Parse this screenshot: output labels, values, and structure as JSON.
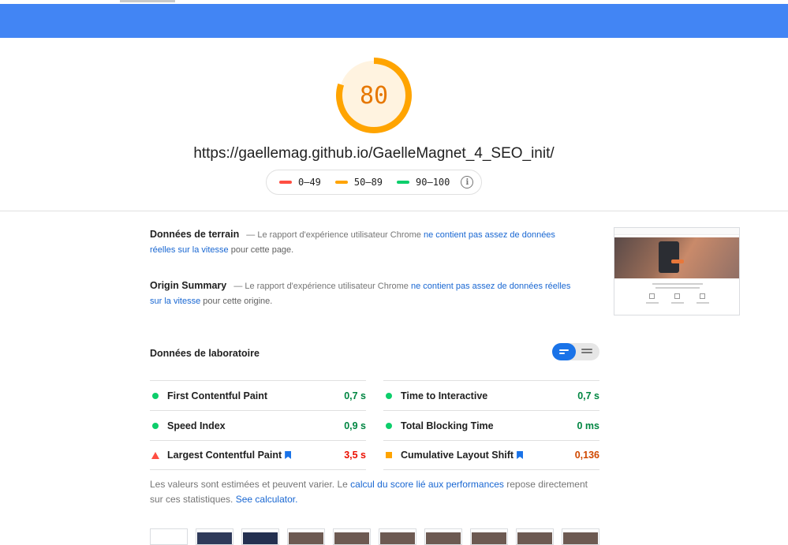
{
  "score": {
    "value": "80",
    "fraction": 0.8,
    "color": "#ffa400"
  },
  "url": "https://gaellemag.github.io/GaelleMagnet_4_SEO_init/",
  "legend": [
    {
      "range": "0–49",
      "status": "fail",
      "color": "#ff4e42"
    },
    {
      "range": "50–89",
      "status": "average",
      "color": "#ffa400"
    },
    {
      "range": "90–100",
      "status": "pass",
      "color": "#0cce6b"
    }
  ],
  "field_data": {
    "title": "Données de terrain",
    "prefix": "— Le rapport d'expérience utilisateur Chrome",
    "link": "ne contient pas assez de données réelles sur la vitesse",
    "suffix": "pour cette page."
  },
  "origin_summary": {
    "title": "Origin Summary",
    "prefix": "— Le rapport d'expérience utilisateur Chrome",
    "link": "ne contient pas assez de données réelles sur la vitesse",
    "suffix": "pour cette origine."
  },
  "lab": {
    "title": "Données de laboratoire",
    "metrics_left": [
      {
        "name": "First Contentful Paint",
        "value": "0,7 s",
        "status": "pass"
      },
      {
        "name": "Speed Index",
        "value": "0,9 s",
        "status": "pass"
      },
      {
        "name": "Largest Contentful Paint",
        "value": "3,5 s",
        "status": "fail",
        "bookmark": true
      }
    ],
    "metrics_right": [
      {
        "name": "Time to Interactive",
        "value": "0,7 s",
        "status": "pass"
      },
      {
        "name": "Total Blocking Time",
        "value": "0 ms",
        "status": "pass"
      },
      {
        "name": "Cumulative Layout Shift",
        "value": "0,136",
        "status": "average",
        "bookmark": true
      }
    ]
  },
  "note": {
    "part1": "Les valeurs sont estimées et peuvent varier. Le",
    "link1": "calcul du score lié aux performances",
    "part2": "repose directement sur ces statistiques.",
    "link2": "See calculator."
  },
  "colors": {
    "header": "#4285f4",
    "pass": "#0cce6b",
    "average": "#ffa400",
    "fail": "#ff4e42",
    "link": "#1967d2"
  }
}
